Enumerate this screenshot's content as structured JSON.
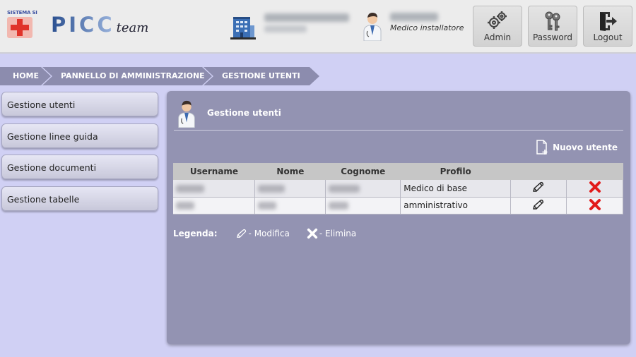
{
  "header": {
    "system_logo_text": "SISTEMA SI",
    "brand_name": "PICC",
    "brand_suffix": "team",
    "user_role": "Medico installatore",
    "buttons": [
      {
        "label": "Admin",
        "icon": "gears-icon"
      },
      {
        "label": "Password",
        "icon": "keys-icon"
      },
      {
        "label": "Logout",
        "icon": "logout-icon"
      }
    ]
  },
  "breadcrumb": [
    "HOME",
    "PANNELLO DI AMMINISTRAZIONE",
    "GESTIONE UTENTI"
  ],
  "sidebar": {
    "items": [
      "Gestione utenti",
      "Gestione linee guida",
      "Gestione documenti",
      "Gestione tabelle"
    ]
  },
  "panel": {
    "title": "Gestione utenti",
    "new_user_label": "Nuovo utente",
    "table": {
      "columns": [
        "Username",
        "Nome",
        "Cognome",
        "Profilo"
      ],
      "rows": [
        {
          "profilo": "Medico di base"
        },
        {
          "profilo": "amministrativo"
        }
      ]
    },
    "legend": {
      "title": "Legenda:",
      "edit_label": "- Modifica",
      "delete_label": "- Elimina"
    }
  },
  "colors": {
    "page_bg": "#d0d0f4",
    "panel_bg": "#9393b2",
    "breadcrumb_bg": "#8c8cae",
    "delete_red": "#e21b1b"
  }
}
